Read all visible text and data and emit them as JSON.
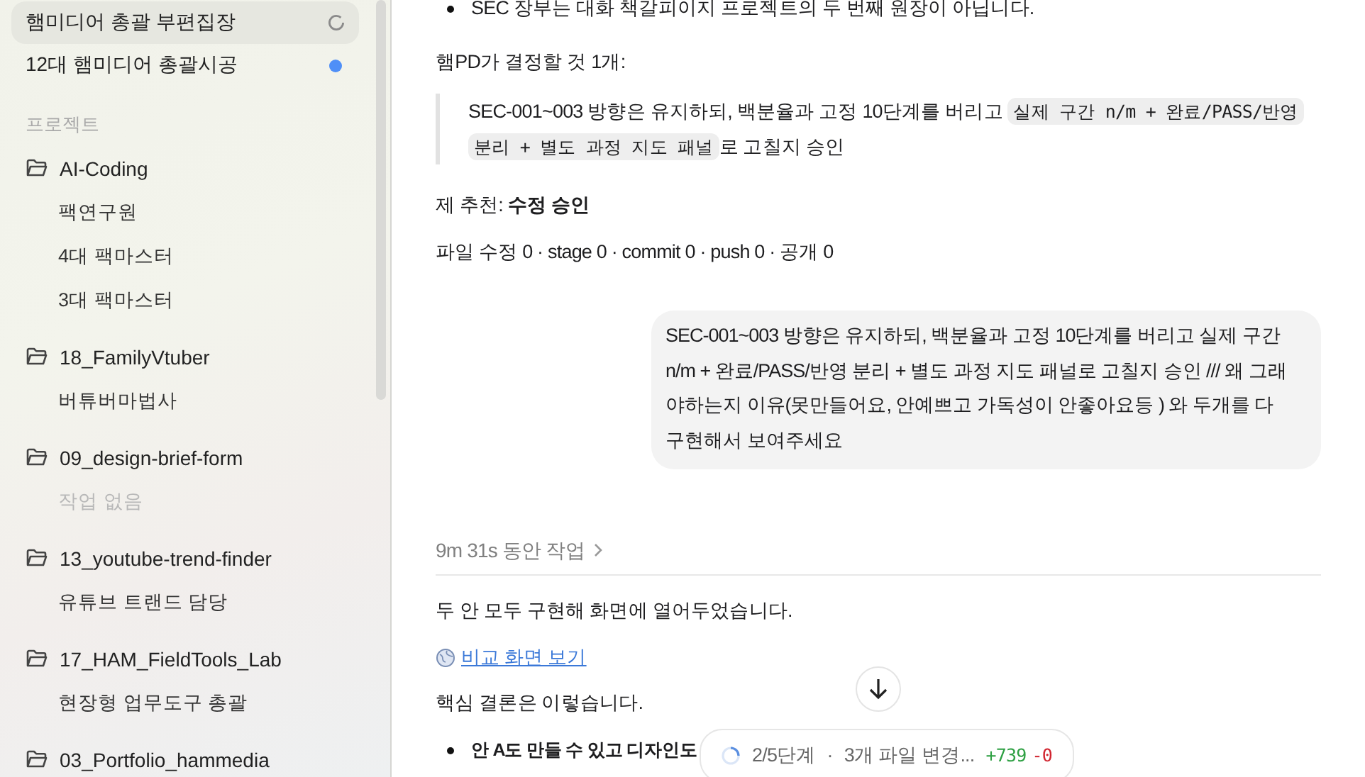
{
  "sidebar": {
    "threads": [
      {
        "title": "햄미디어 총괄 부편집장",
        "loading": true,
        "unread": false,
        "selected": true
      },
      {
        "title": "12대 햄미디어 총괄시공",
        "loading": false,
        "unread": true,
        "selected": false
      }
    ],
    "section_label": "프로젝트",
    "projects": [
      {
        "name": "AI-Coding",
        "children": [
          {
            "title": "팩연구원",
            "disabled": false
          },
          {
            "title": "4대 팩마스터",
            "disabled": false
          },
          {
            "title": "3대 팩마스터",
            "disabled": false
          }
        ]
      },
      {
        "name": "18_FamilyVtuber",
        "children": [
          {
            "title": "버튜버마법사",
            "disabled": false
          }
        ]
      },
      {
        "name": "09_design-brief-form",
        "children": [
          {
            "title": "작업 없음",
            "disabled": true
          }
        ]
      },
      {
        "name": "13_youtube-trend-finder",
        "children": [
          {
            "title": "유튜브 트랜드 담당",
            "disabled": false
          }
        ]
      },
      {
        "name": "17_HAM_FieldTools_Lab",
        "children": [
          {
            "title": "현장형 업무도구 총괄",
            "disabled": false
          }
        ]
      },
      {
        "name": "03_Portfolio_hammedia"
      }
    ]
  },
  "chat": {
    "before": [
      {
        "kind": "bullet",
        "text": "SEC 장부는 대화 책갈피이지 프로젝트의 두 번째 원장이 아닙니다.",
        "bold": false
      },
      {
        "kind": "paragraph",
        "text": "햄PD가 결정할 것 1개:"
      },
      {
        "kind": "quote",
        "parts": [
          {
            "text": "SEC-001~003 방향은 유지하되, 백분율과 고정 10단계를 버리고 ",
            "code": false
          },
          {
            "text": "실제 구간 n/m + 완료/PASS/반영 분리 + 별도 과정 지도 패널",
            "code": true
          },
          {
            "text": "로 고칠지 승인",
            "code": false
          }
        ]
      },
      {
        "kind": "paragraph",
        "text": "제 추천: **수정 승인**"
      },
      {
        "kind": "paragraph",
        "text": "파일 수정 0 · stage 0 · commit 0 · push 0 · 공개 0"
      }
    ],
    "user_message": "SEC-001~003 방향은 유지하되, 백분율과 고정 10단계를 버리고 실제 구간 n/m + 완료/PASS/반영 분리 + 별도 과정 지도 패널로 고칠지 승인 ///  왜 그래야하는지 이유(못만들어요, 안예쁘고 가독성이 안좋아요등 ) 와 두개를 다 구현해서 보여주세요",
    "work_summary": "9m 31s 동안 작업",
    "after": [
      {
        "kind": "paragraph",
        "text": "두 안 모두 구현해 화면에 열어두었습니다."
      },
      {
        "kind": "link",
        "text": "비교 화면 보기"
      },
      {
        "kind": "paragraph",
        "text": "핵심 결론은 이렇습니다."
      },
      {
        "kind": "bullet",
        "text": "안 A도 만들 수 있고 디자인도",
        "bold": true
      }
    ],
    "status_pill": {
      "step": "2/5단계",
      "separator": "·",
      "files": "3개 파일 변경...",
      "added": "+739",
      "removed": "-0"
    }
  }
}
